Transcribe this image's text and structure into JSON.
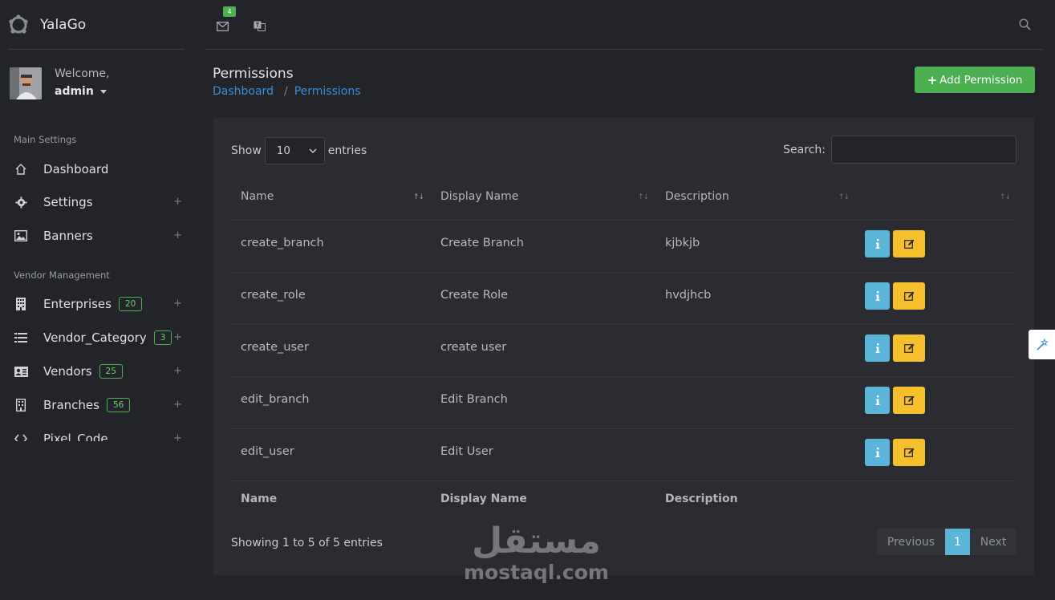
{
  "brand": {
    "name": "YalaGo"
  },
  "user": {
    "welcome": "Welcome,",
    "name": "admin"
  },
  "sidebar": {
    "sections": [
      {
        "title": "Main Settings"
      },
      {
        "title": "Vendor Management"
      }
    ],
    "items": [
      {
        "label": "Dashboard",
        "icon": "home-icon"
      },
      {
        "label": "Settings",
        "icon": "gear-icon",
        "expand": "+"
      },
      {
        "label": "Banners",
        "icon": "image-icon",
        "expand": "+"
      },
      {
        "label": "Enterprises",
        "icon": "building-icon",
        "badge": "20",
        "expand": "+"
      },
      {
        "label": "Vendor_Category",
        "icon": "list-icon",
        "badge": "3",
        "expand": "+"
      },
      {
        "label": "Vendors",
        "icon": "id-card-icon",
        "badge": "25",
        "expand": "+"
      },
      {
        "label": "Branches",
        "icon": "office-icon",
        "badge": "56",
        "expand": "+"
      },
      {
        "label": "Pixel_Code",
        "icon": "code-icon",
        "expand": "+"
      }
    ]
  },
  "topbar": {
    "notifications_count": "4"
  },
  "page": {
    "title": "Permissions",
    "breadcrumb": [
      "Dashboard",
      "Permissions"
    ],
    "breadcrumb_sep": "/",
    "add_button": "Add Permission"
  },
  "table": {
    "show_label": "Show",
    "page_size": "10",
    "entries_label": "entries",
    "search_label": "Search:",
    "columns": [
      "Name",
      "Display Name",
      "Description"
    ],
    "rows": [
      {
        "name": "create_branch",
        "display": "Create Branch",
        "desc": "kjbkjb"
      },
      {
        "name": "create_role",
        "display": "Create Role",
        "desc": "hvdjhcb"
      },
      {
        "name": "create_user",
        "display": "create user",
        "desc": ""
      },
      {
        "name": "edit_branch",
        "display": "Edit Branch",
        "desc": ""
      },
      {
        "name": "edit_user",
        "display": "Edit User",
        "desc": ""
      }
    ],
    "info": "Showing 1 to 5 of 5 entries",
    "pagination": {
      "previous": "Previous",
      "current": "1",
      "next": "Next"
    }
  },
  "watermark": {
    "arabic": "مستقل",
    "latin": "mostaql.com"
  },
  "colors": {
    "accent_green": "#4caf50",
    "info_blue": "#5bb5d8",
    "edit_yellow": "#f5c02c",
    "link_blue": "#3b8fe0"
  }
}
